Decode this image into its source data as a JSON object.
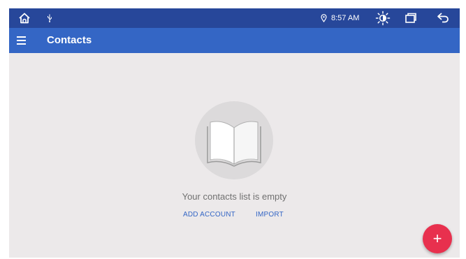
{
  "status_bar": {
    "time": "8:57 AM",
    "icons": [
      "home-icon",
      "usb-icon",
      "location-icon",
      "brightness-icon",
      "recent-apps-icon",
      "back-icon"
    ]
  },
  "app_bar": {
    "menu_icon": "menu-icon",
    "title": "Contacts"
  },
  "empty_state": {
    "illustration": "book-icon",
    "message": "Your contacts list is empty",
    "add_account_label": "ADD ACCOUNT",
    "import_label": "IMPORT"
  },
  "fab": {
    "label": "+",
    "icon": "add-icon"
  },
  "colors": {
    "status_bar": "#27479a",
    "app_bar": "#3466c5",
    "background": "#ece9ea",
    "fab": "#e8304e",
    "link": "#3466c5"
  }
}
